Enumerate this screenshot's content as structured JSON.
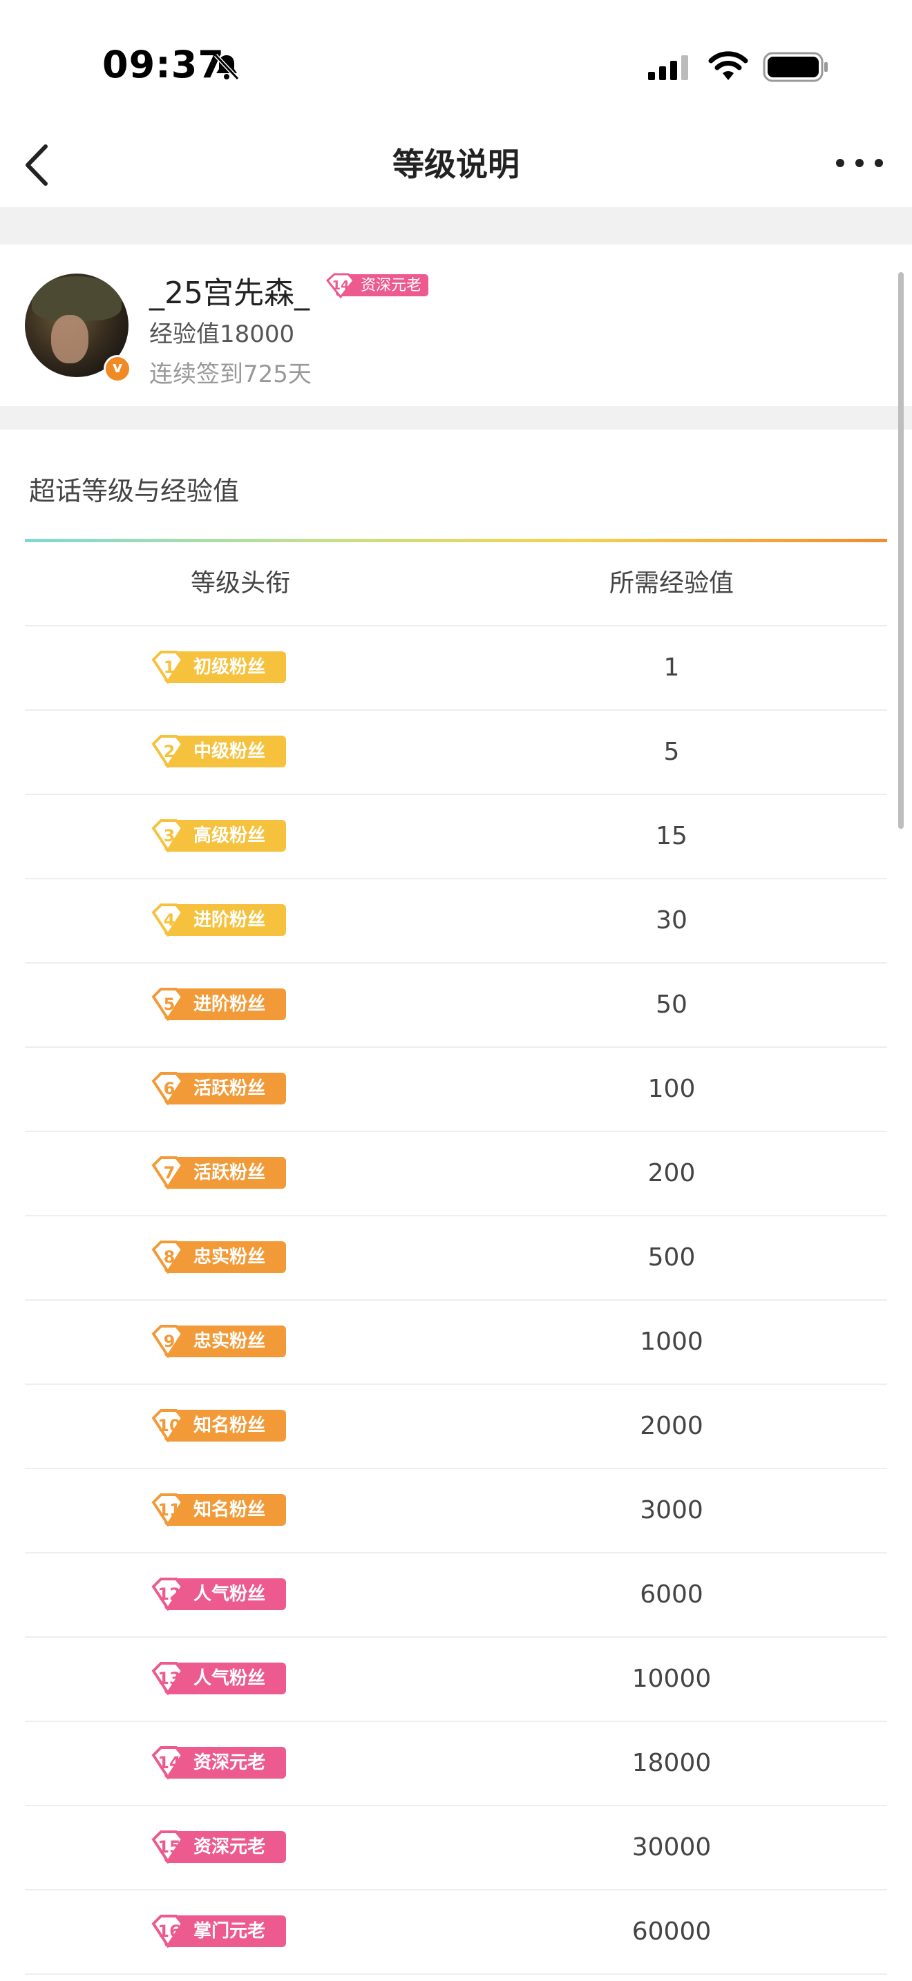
{
  "status_bar": {
    "time": "09:37"
  },
  "nav": {
    "title": "等级说明"
  },
  "profile": {
    "username": "_25宫先森_",
    "level_badge": {
      "level": "14",
      "title": "资深元老"
    },
    "exp": "经验值18000",
    "checkin": "连续签到725天"
  },
  "section": {
    "title": "超话等级与经验值",
    "header_title": "等级头衔",
    "header_exp": "所需经验值"
  },
  "levels": [
    {
      "level": "1",
      "title": "初级粉丝",
      "exp": "1",
      "color": "#f6c23e"
    },
    {
      "level": "2",
      "title": "中级粉丝",
      "exp": "5",
      "color": "#f6c23e"
    },
    {
      "level": "3",
      "title": "高级粉丝",
      "exp": "15",
      "color": "#f6c23e"
    },
    {
      "level": "4",
      "title": "进阶粉丝",
      "exp": "30",
      "color": "#f6c23e"
    },
    {
      "level": "5",
      "title": "进阶粉丝",
      "exp": "50",
      "color": "#f29a38"
    },
    {
      "level": "6",
      "title": "活跃粉丝",
      "exp": "100",
      "color": "#f29a38"
    },
    {
      "level": "7",
      "title": "活跃粉丝",
      "exp": "200",
      "color": "#f29a38"
    },
    {
      "level": "8",
      "title": "忠实粉丝",
      "exp": "500",
      "color": "#f29a38"
    },
    {
      "level": "9",
      "title": "忠实粉丝",
      "exp": "1000",
      "color": "#f29a38"
    },
    {
      "level": "10",
      "title": "知名粉丝",
      "exp": "2000",
      "color": "#f29a38"
    },
    {
      "level": "11",
      "title": "知名粉丝",
      "exp": "3000",
      "color": "#f29a38"
    },
    {
      "level": "12",
      "title": "人气粉丝",
      "exp": "6000",
      "color": "#ec5a8e"
    },
    {
      "level": "13",
      "title": "人气粉丝",
      "exp": "10000",
      "color": "#ec5a8e"
    },
    {
      "level": "14",
      "title": "资深元老",
      "exp": "18000",
      "color": "#ec5a8e"
    },
    {
      "level": "15",
      "title": "资深元老",
      "exp": "30000",
      "color": "#ec5a8e"
    },
    {
      "level": "16",
      "title": "掌门元老",
      "exp": "60000",
      "color": "#ec5a8e"
    }
  ]
}
